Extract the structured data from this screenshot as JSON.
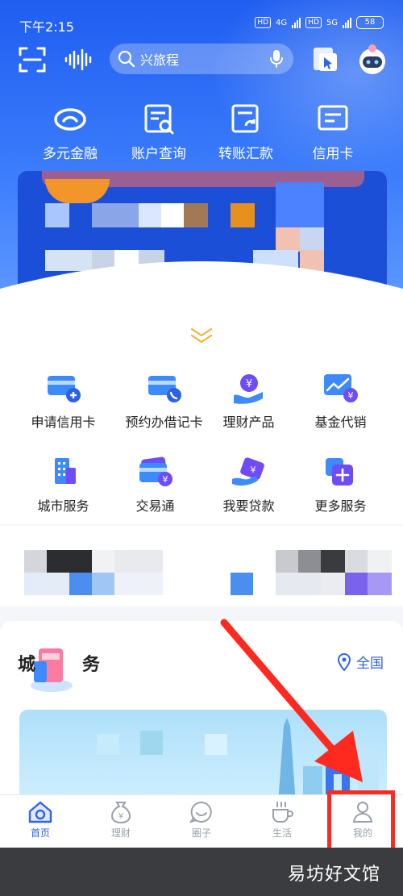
{
  "status_bar": {
    "time": "下午2:15",
    "hd1": "HD",
    "net1": "4G",
    "hd2": "HD",
    "net2": "5G",
    "battery": "58"
  },
  "search": {
    "placeholder": "兴旅程"
  },
  "quick_actions": [
    {
      "label": "多元金融"
    },
    {
      "label": "账户查询"
    },
    {
      "label": "转账汇款"
    },
    {
      "label": "信用卡"
    }
  ],
  "services": [
    {
      "label": "申请信用卡"
    },
    {
      "label": "预约办借记卡"
    },
    {
      "label": "理财产品"
    },
    {
      "label": "基金代销"
    },
    {
      "label": "城市服务"
    },
    {
      "label": "交易通"
    },
    {
      "label": "我要贷款"
    },
    {
      "label": "更多服务"
    }
  ],
  "city_section": {
    "title_left": "城",
    "title_right": "务",
    "location": "全国"
  },
  "tabs": [
    {
      "label": "首页"
    },
    {
      "label": "理财"
    },
    {
      "label": "圈子"
    },
    {
      "label": "生活"
    },
    {
      "label": "我的"
    }
  ],
  "watermark": "易坊好文馆",
  "colors": {
    "primary": "#2f63e8",
    "header_top": "#1f5ef0",
    "highlight": "#ff2a1f"
  }
}
